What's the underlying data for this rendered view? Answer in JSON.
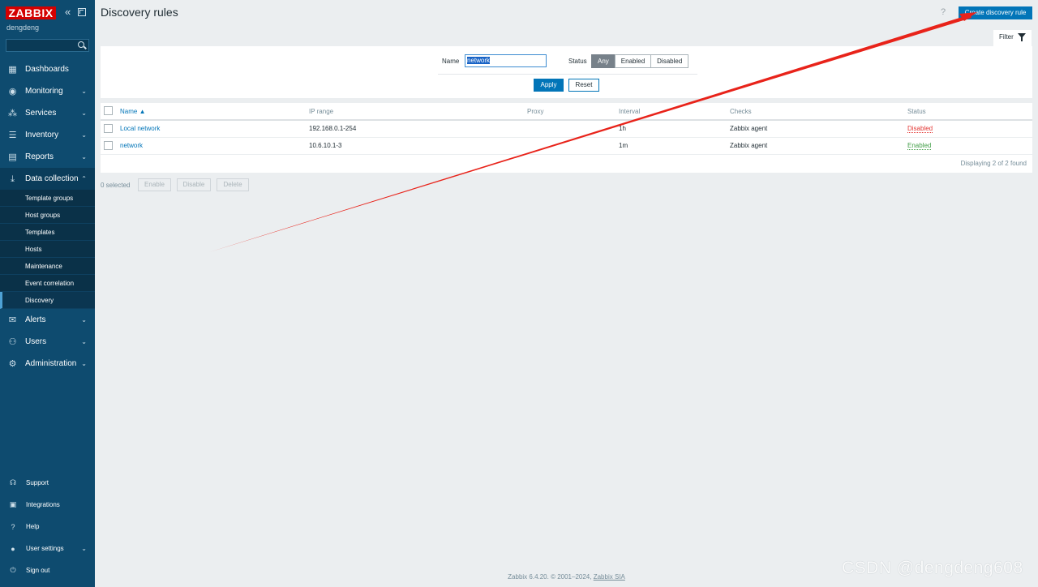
{
  "sidebar": {
    "logo": "ZABBIX",
    "username": "dengdeng",
    "search_placeholder": "",
    "menu": [
      {
        "label": "Dashboards",
        "icon": "dashboard-icon"
      },
      {
        "label": "Monitoring",
        "icon": "eye-icon"
      },
      {
        "label": "Services",
        "icon": "services-icon"
      },
      {
        "label": "Inventory",
        "icon": "list-icon"
      },
      {
        "label": "Reports",
        "icon": "report-icon"
      },
      {
        "label": "Data collection",
        "icon": "download-icon"
      },
      {
        "label": "Alerts",
        "icon": "envelope-icon"
      },
      {
        "label": "Users",
        "icon": "users-icon"
      },
      {
        "label": "Administration",
        "icon": "gear-icon"
      }
    ],
    "submenu": [
      "Template groups",
      "Host groups",
      "Templates",
      "Hosts",
      "Maintenance",
      "Event correlation",
      "Discovery"
    ],
    "bottom": [
      {
        "label": "Support",
        "icon": "headset-icon"
      },
      {
        "label": "Integrations",
        "icon": "integrations-icon"
      },
      {
        "label": "Help",
        "icon": "help-icon"
      },
      {
        "label": "User settings",
        "icon": "user-icon"
      },
      {
        "label": "Sign out",
        "icon": "power-icon"
      }
    ]
  },
  "header": {
    "title": "Discovery rules",
    "help": "?",
    "create_label": "Create discovery rule"
  },
  "filter": {
    "tab_label": "Filter",
    "name_label": "Name",
    "name_value": "network",
    "status_label": "Status",
    "status_options": [
      "Any",
      "Enabled",
      "Disabled"
    ],
    "status_selected": "Any",
    "apply_label": "Apply",
    "reset_label": "Reset"
  },
  "table": {
    "columns": [
      "Name ▲",
      "IP range",
      "Proxy",
      "Interval",
      "Checks",
      "Status"
    ],
    "rows": [
      {
        "name": "Local network",
        "ip_range": "192.168.0.1-254",
        "proxy": "",
        "interval": "1h",
        "checks": "Zabbix agent",
        "status": "Disabled"
      },
      {
        "name": "network",
        "ip_range": "10.6.10.1-3",
        "proxy": "",
        "interval": "1m",
        "checks": "Zabbix agent",
        "status": "Enabled"
      }
    ],
    "displaying": "Displaying 2 of 2 found"
  },
  "actions": {
    "selected": "0 selected",
    "enable": "Enable",
    "disable": "Disable",
    "delete": "Delete"
  },
  "footer": {
    "text": "Zabbix 6.4.20. © 2001–2024,",
    "link": "Zabbix SIA"
  },
  "watermark": "CSDN @dengdeng608",
  "annotation_color": "#e8231a"
}
